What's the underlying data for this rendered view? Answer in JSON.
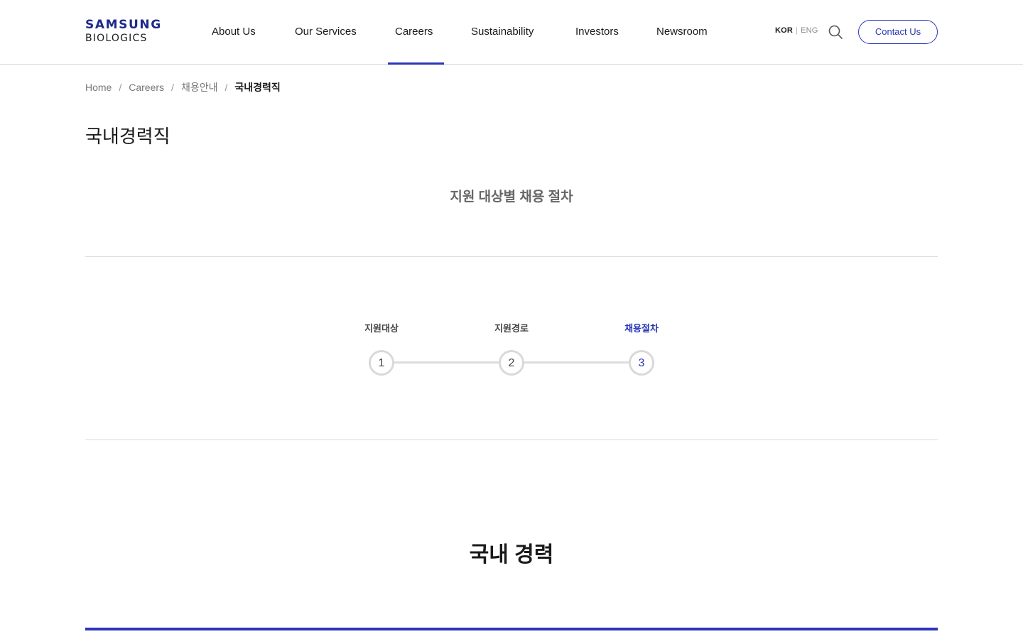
{
  "brand": {
    "line1": "SAMSUNG",
    "line2": "BIOLOGICS",
    "accent_color": "#2a35b8"
  },
  "nav": {
    "items": [
      {
        "label": "About Us"
      },
      {
        "label": "Our Services"
      },
      {
        "label": "Careers",
        "active": true
      },
      {
        "label": "Sustainability"
      },
      {
        "label": "Investors"
      },
      {
        "label": "Newsroom"
      }
    ]
  },
  "lang": {
    "kor": "KOR",
    "separator": "|",
    "eng": "ENG"
  },
  "header": {
    "search_icon": "search-icon",
    "contact_label": "Contact Us"
  },
  "breadcrumb": {
    "items": [
      "Home",
      "Careers",
      "채용안내"
    ],
    "separator": "/",
    "current": "국내경력직"
  },
  "page": {
    "title": "국내경력직",
    "section_subtitle": "지원 대상별 채용 절차"
  },
  "steps": {
    "items": [
      {
        "label": "지원대상",
        "number": "1"
      },
      {
        "label": "지원경로",
        "number": "2"
      },
      {
        "label": "채용절차",
        "number": "3",
        "active": true
      }
    ]
  },
  "section": {
    "title": "국내 경력"
  }
}
